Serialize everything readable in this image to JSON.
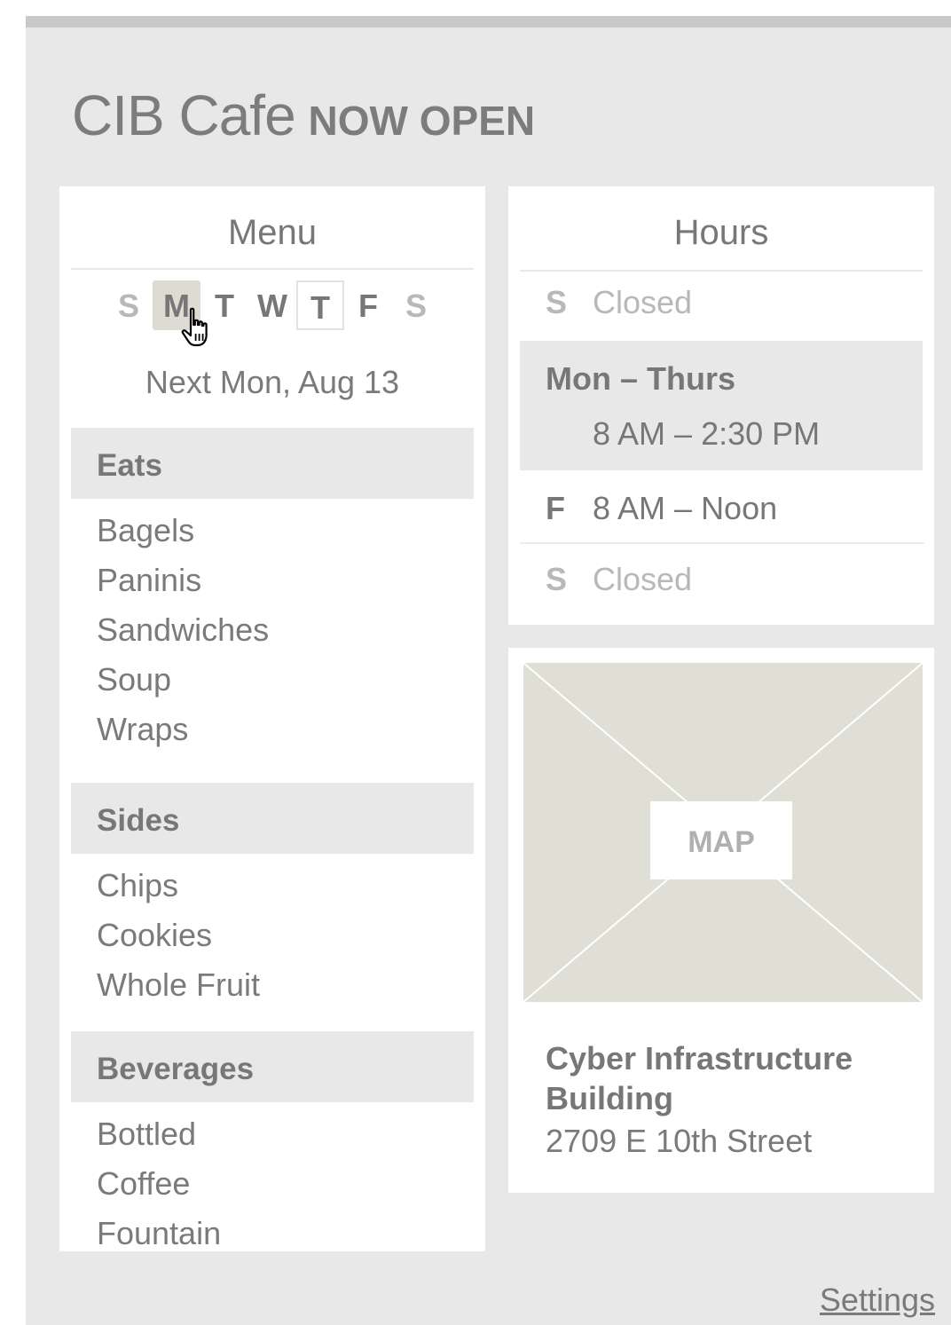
{
  "app": {
    "name": "CIB Cafe",
    "status": "NOW OPEN"
  },
  "menu": {
    "heading": "Menu",
    "days": [
      {
        "letter": "S",
        "state": "weekend"
      },
      {
        "letter": "M",
        "state": "selected"
      },
      {
        "letter": "T",
        "state": "normal"
      },
      {
        "letter": "W",
        "state": "normal"
      },
      {
        "letter": "T",
        "state": "today"
      },
      {
        "letter": "F",
        "state": "normal"
      },
      {
        "letter": "S",
        "state": "weekend"
      }
    ],
    "selected_date": "Next Mon, Aug 13",
    "categories": [
      {
        "name": "Eats",
        "items": [
          "Bagels",
          "Paninis",
          "Sandwiches",
          "Soup",
          "Wraps"
        ]
      },
      {
        "name": "Sides",
        "items": [
          "Chips",
          "Cookies",
          "Whole Fruit"
        ]
      },
      {
        "name": "Beverages",
        "items": [
          "Bottled",
          "Coffee",
          "Fountain"
        ]
      }
    ]
  },
  "hours": {
    "heading": "Hours",
    "rows": [
      {
        "day": "S",
        "time": "Closed"
      },
      {
        "day": "Mon – Thurs",
        "time": "8 AM – 2:30 PM"
      },
      {
        "day": "F",
        "time": "8 AM – Noon"
      },
      {
        "day": "S",
        "time": "Closed"
      }
    ]
  },
  "location": {
    "map_label": "MAP",
    "building": "Cyber Infrastructure Building",
    "address": "2709 E 10th Street"
  },
  "footer": {
    "settings_label": "Settings"
  },
  "colors": {
    "background": "#e8e8e8",
    "panel": "#ffffff",
    "text": "#7a7a7a",
    "muted": "#b8b8b8",
    "selected_day": "#dddbd2",
    "map_fill": "#e0dfd5"
  },
  "icons": {
    "cursor": "hand-pointer-icon"
  }
}
